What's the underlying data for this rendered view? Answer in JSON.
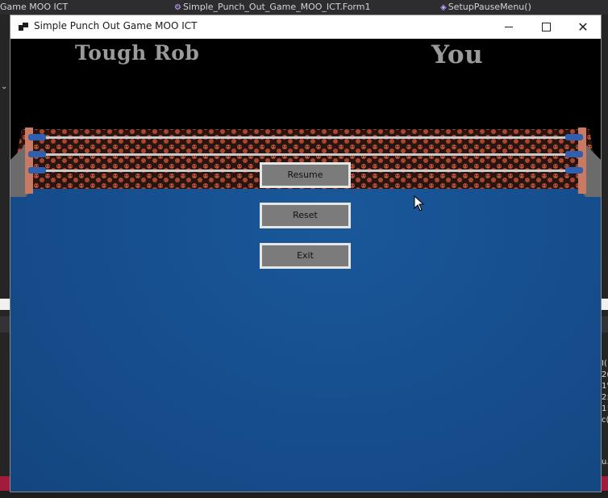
{
  "ide": {
    "tabs": [
      {
        "label": "Game MOO ICT"
      },
      {
        "label": "Simple_Punch_Out_Game_MOO_ICT.Form1"
      },
      {
        "label": "SetupPauseMenu()"
      }
    ],
    "left_fragment": "Nã",
    "right_fragments": [
      "I(",
      "2(",
      "1'",
      "2:",
      "1!",
      "c("
    ],
    "right_fragment_bottom": "u."
  },
  "window": {
    "title": "Simple Punch Out Game MOO ICT",
    "controls": {
      "minimize": "minimize",
      "maximize": "maximize",
      "close": "close"
    }
  },
  "game": {
    "enemy_name": "Tough Rob",
    "player_name": "You",
    "colors": {
      "ring_floor": "#174f8f",
      "crowd": "#b5533a",
      "name_text": "#9a9a9a",
      "button_face": "#7b7b7b",
      "button_border": "#e6e6e6"
    }
  },
  "pause_menu": {
    "resume": "Resume",
    "reset": "Reset",
    "exit": "Exit"
  }
}
